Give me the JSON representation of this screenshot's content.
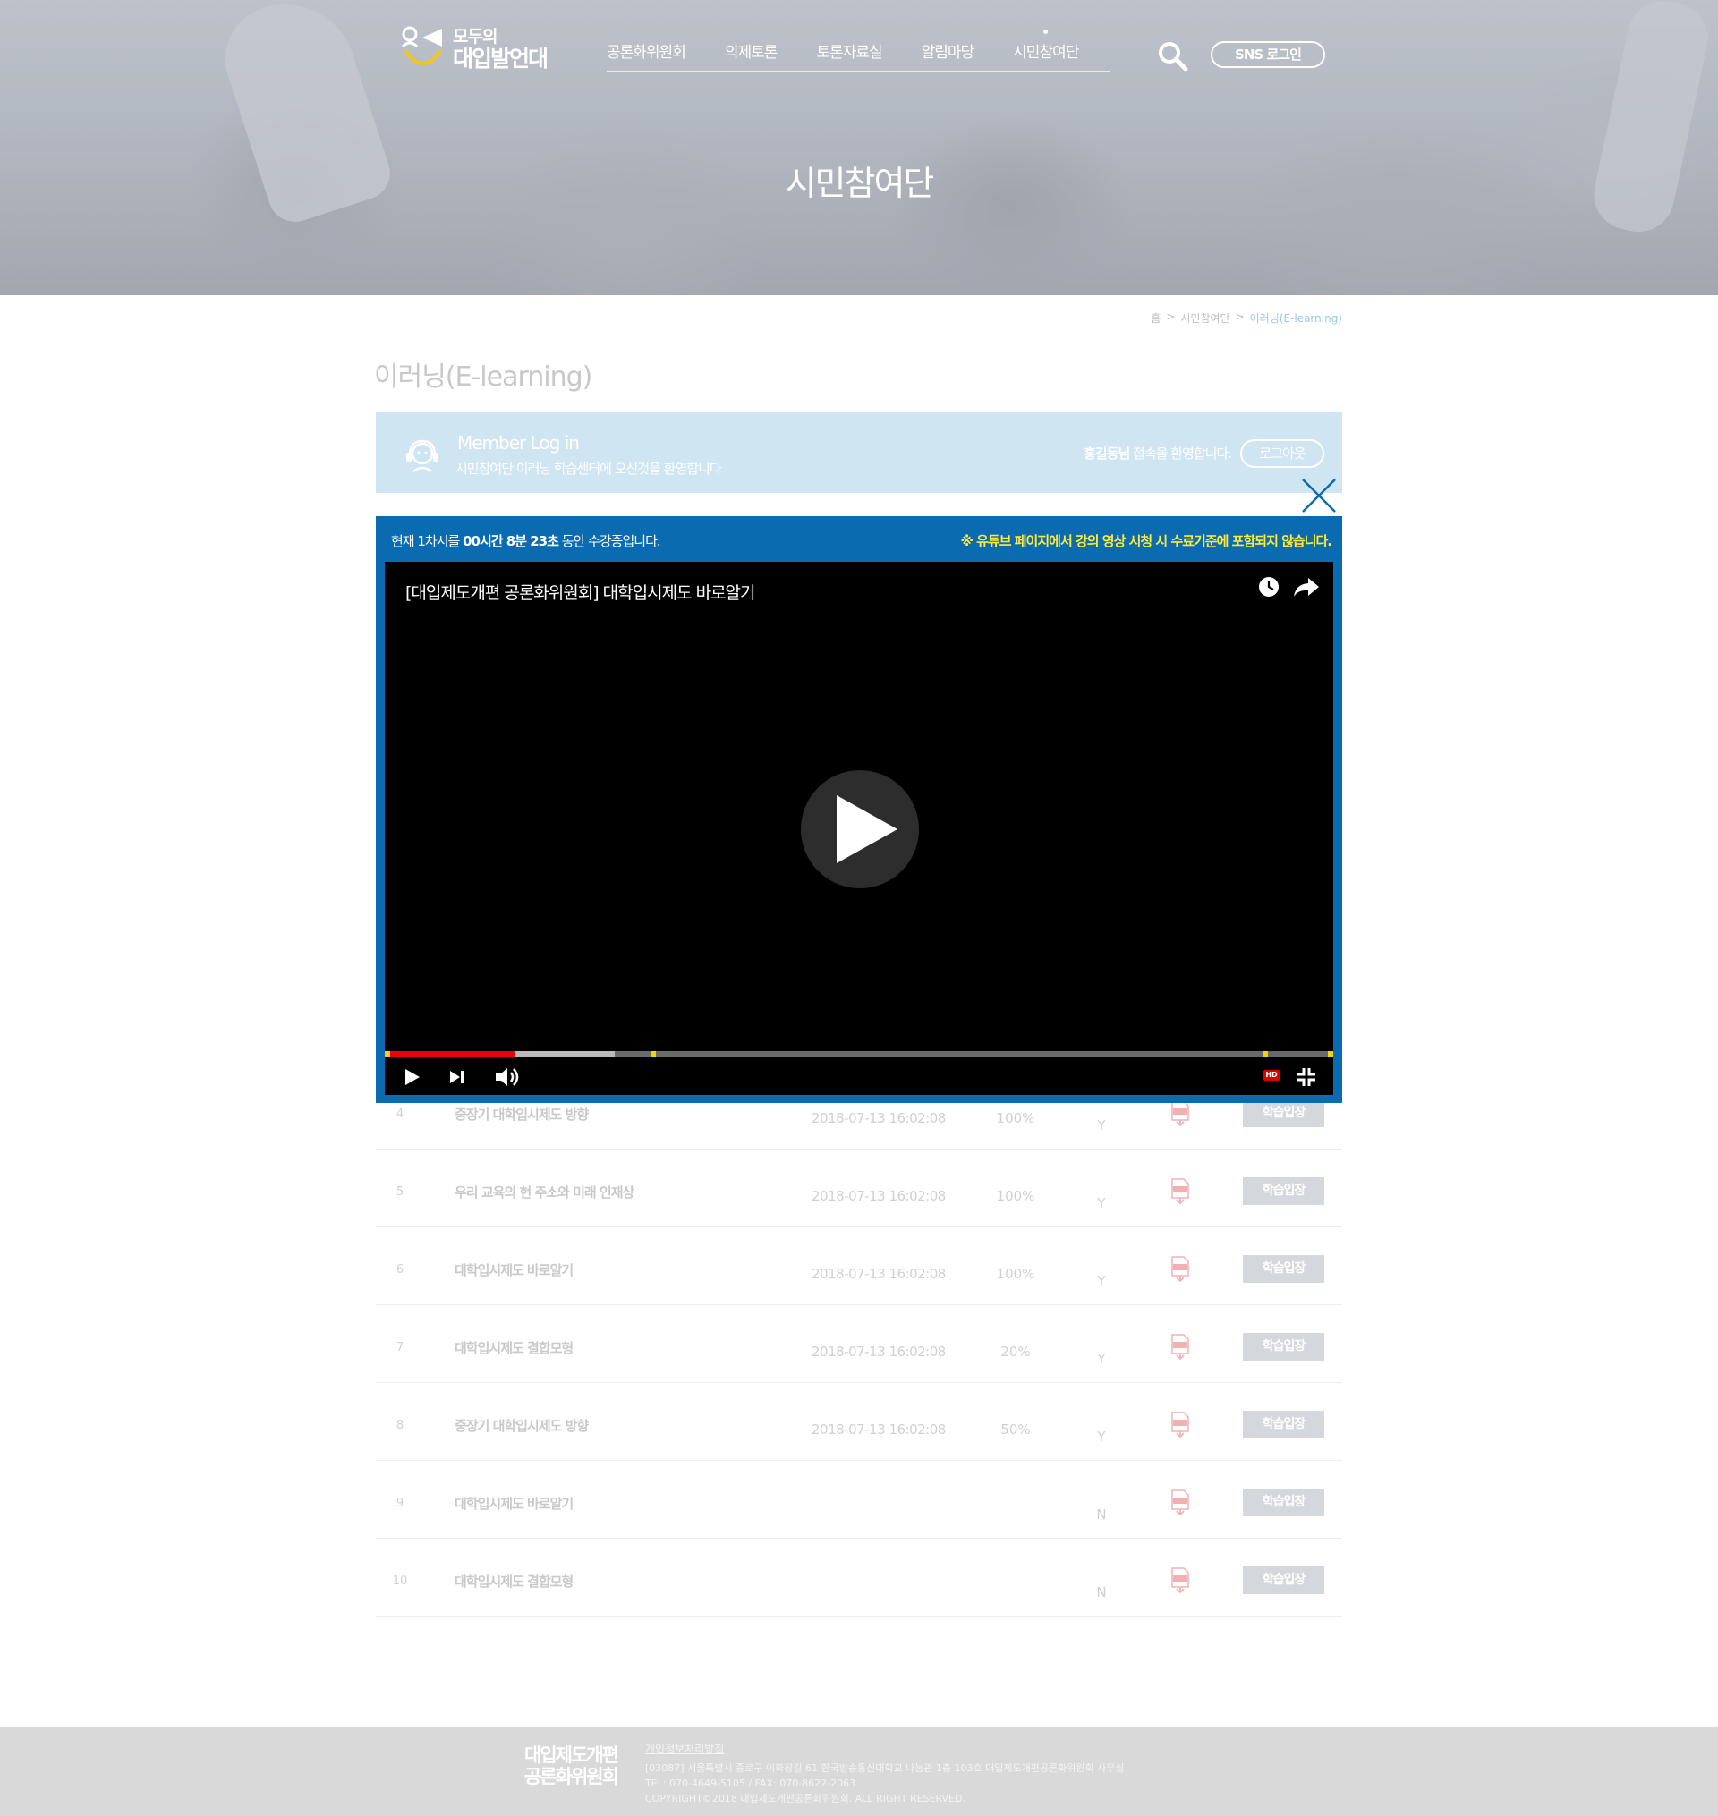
{
  "header": {
    "logo_line1": "모두의",
    "logo_line2": "대입발언대",
    "nav": [
      "공론화위원회",
      "의제토론",
      "토론자료실",
      "알림마당",
      "시민참여단"
    ],
    "sns_login": "SNS 로그인"
  },
  "hero": {
    "title": "시민참여단"
  },
  "breadcrumb": {
    "home": "홈",
    "sep": ">",
    "section": "시민참여단",
    "current": "이러닝(E-learning)"
  },
  "page_title": "이러닝(E-learning)",
  "login_bar": {
    "title": "Member Log in",
    "subtitle": "시민참여단 이러닝 학습센터에 오신것을 환영합니다",
    "user_name": "홍길동님",
    "welcome": " 접속을 환영합니다.",
    "logout": "로그아웃"
  },
  "modal": {
    "info_prefix": "현재 1차시를 ",
    "info_time": "00시간 8분 23초",
    "info_suffix": " 동안 수강중입니다.",
    "notice": "※ 유튜브 페이지에서 강의 영상 시청 시 수료기준에 포함되지 않습니다.",
    "video_title": "[대입제도개편 공론화위원회] 대학입시제도 바로알기",
    "hd_label": "HD",
    "progress": {
      "played": 0.137,
      "buffered": 0.242
    }
  },
  "rows": [
    {
      "no": "4",
      "title": "중장기 대학입시제도 방향",
      "date": "2018-07-13 16:02:08",
      "pct": "100%",
      "yn": "Y",
      "btn": "학습입장"
    },
    {
      "no": "5",
      "title": "우리 교육의 현 주소와 미래 인재상",
      "date": "2018-07-13 16:02:08",
      "pct": "100%",
      "yn": "Y",
      "btn": "학습입장"
    },
    {
      "no": "6",
      "title": "대학입시제도 바로알기",
      "date": "2018-07-13 16:02:08",
      "pct": "100%",
      "yn": "Y",
      "btn": "학습입장"
    },
    {
      "no": "7",
      "title": "대학입시제도 결합모형",
      "date": "2018-07-13 16:02:08",
      "pct": "20%",
      "yn": "Y",
      "btn": "학습입장"
    },
    {
      "no": "8",
      "title": "중장기 대학입시제도 방향",
      "date": "2018-07-13 16:02:08",
      "pct": "50%",
      "yn": "Y",
      "btn": "학습입장"
    },
    {
      "no": "9",
      "title": "대학입시제도 바로알기",
      "date": "",
      "pct": "",
      "yn": "N",
      "btn": "학습입장"
    },
    {
      "no": "10",
      "title": "대학입시제도 결합모형",
      "date": "",
      "pct": "",
      "yn": "N",
      "btn": "학습입장"
    }
  ],
  "footer": {
    "logo_line1": "대입제도개편",
    "logo_line2": "공론화위원회",
    "policy": "개인정보처리방침",
    "address": "[03087] 서울특별시 종로구 이화장길 61 한국방송통신대학교 나눔관 1층 103호 대입제도개편공론화위원회 사무실",
    "tel": "TEL: 070-4649-5105 / FAX: 070-8622-2063",
    "copyright": "COPYRIGHT©2018 대입제도개편공론화위원회. ALL RIGHT RESERVED."
  }
}
